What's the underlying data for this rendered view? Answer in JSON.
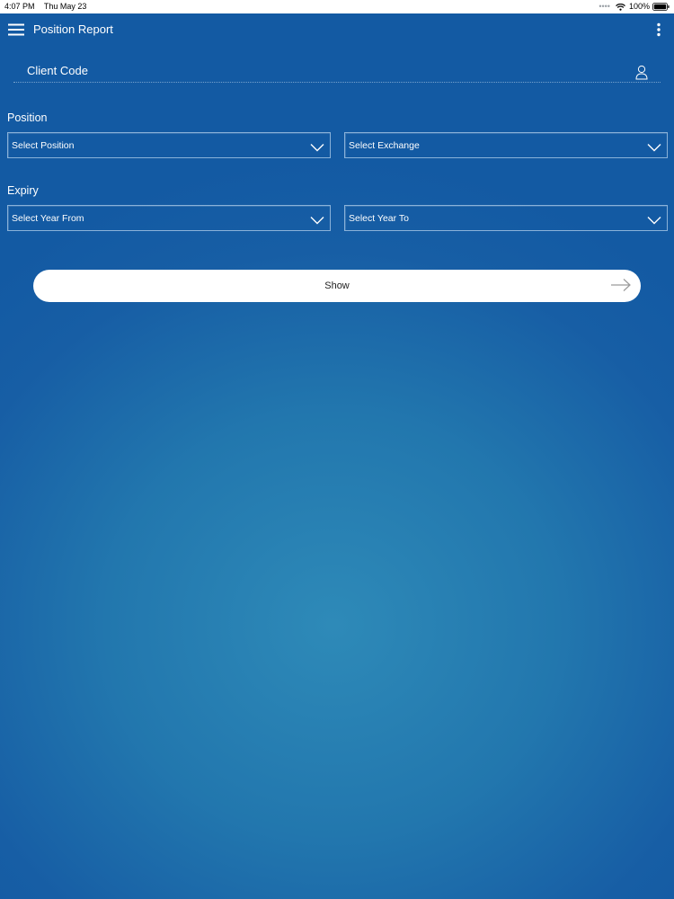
{
  "status_bar": {
    "time": "4:07 PM",
    "date": "Thu May 23",
    "battery": "100%"
  },
  "header": {
    "title": "Position Report",
    "menu_icon": "hamburger-menu-icon",
    "more_icon": "vertical-ellipsis-icon"
  },
  "client_code": {
    "placeholder": "Client Code",
    "value": "",
    "icon": "user-icon"
  },
  "position_section": {
    "label": "Position",
    "position_select": "Select Position",
    "exchange_select": "Select Exchange"
  },
  "expiry_section": {
    "label": "Expiry",
    "year_from_select": "Select Year From",
    "year_to_select": "Select Year To"
  },
  "show_button": {
    "label": "Show",
    "icon": "arrow-right-icon"
  },
  "colors": {
    "background_dark": "#135aa3",
    "background_light": "#2e8ab8",
    "button_bg": "#ffffff",
    "text": "#ffffff"
  }
}
